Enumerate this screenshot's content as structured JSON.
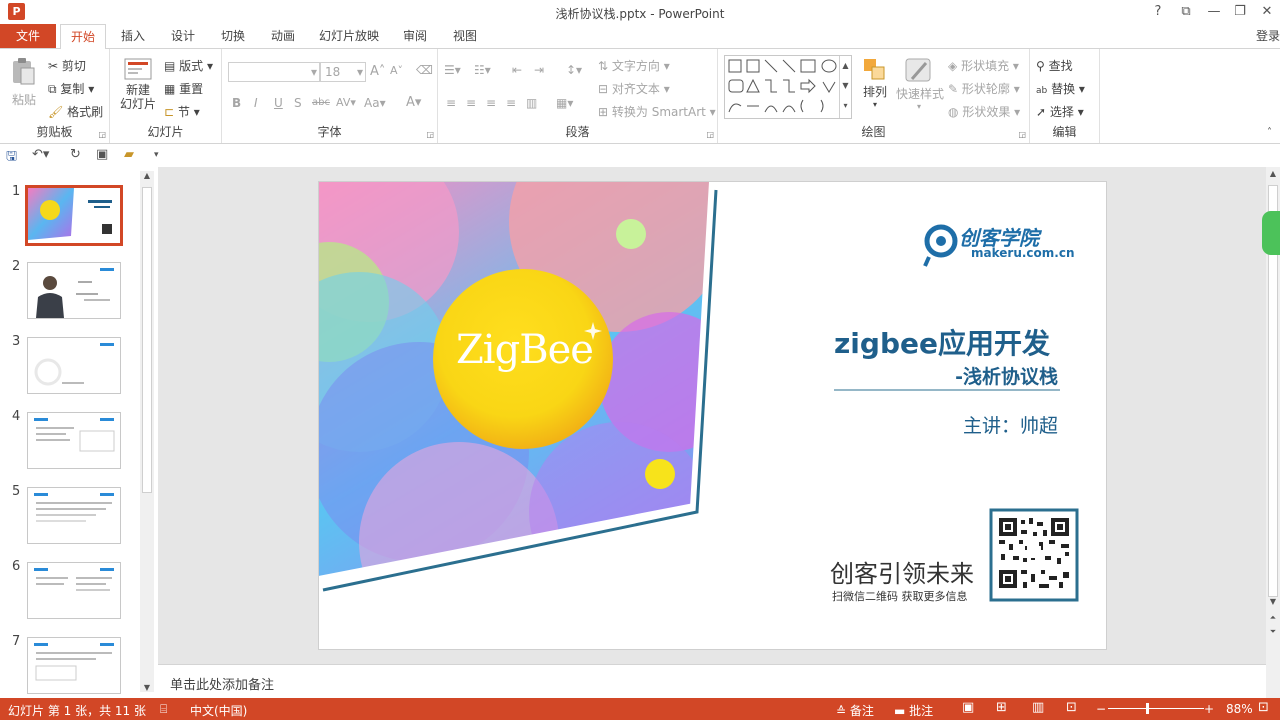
{
  "window": {
    "title": "浅析协议栈.pptx - PowerPoint",
    "app_icon": "P",
    "controls": [
      "?",
      "⧉",
      "—",
      "❐",
      "✕"
    ]
  },
  "tabs": [
    {
      "label": "文件"
    },
    {
      "label": "开始"
    },
    {
      "label": "插入"
    },
    {
      "label": "设计"
    },
    {
      "label": "切换"
    },
    {
      "label": "动画"
    },
    {
      "label": "幻灯片放映"
    },
    {
      "label": "审阅"
    },
    {
      "label": "视图"
    }
  ],
  "account": {
    "login": "登录"
  },
  "ribbon": {
    "clipboard": {
      "label": "剪贴板",
      "paste": "粘贴",
      "cut": "剪切",
      "copy": "复制",
      "format_painter": "格式刷"
    },
    "slides": {
      "label": "幻灯片",
      "new_slide_line1": "新建",
      "new_slide_line2": "幻灯片",
      "layout": "版式",
      "reset": "重置",
      "section": "节"
    },
    "font": {
      "label": "字体",
      "size": "18",
      "bold": "B",
      "italic": "I",
      "underline": "U",
      "shadow": "S",
      "strike": "abc",
      "spacing": "AV",
      "case": "Aa",
      "color": "A",
      "grow": "A",
      "shrink": "A"
    },
    "paragraph": {
      "label": "段落",
      "text_direction": "文字方向",
      "align_text": "对齐文本",
      "smartart": "转换为 SmartArt"
    },
    "drawing": {
      "label": "绘图",
      "arrange": "排列",
      "quick_styles": "快速样式",
      "shape_fill": "形状填充",
      "shape_outline": "形状轮廓",
      "shape_effects": "形状效果"
    },
    "editing": {
      "label": "编辑",
      "find": "查找",
      "replace": "替换",
      "select": "选择"
    }
  },
  "slides_pane": {
    "numbers": [
      "1",
      "2",
      "3",
      "4",
      "5",
      "6",
      "7"
    ],
    "selected": 1
  },
  "slide": {
    "logo_text": "创客学院",
    "logo_url": "makeru.com.cn",
    "zigbee_text": "ZigBee",
    "title": "zigbee应用开发",
    "subtitle": "-浅析协议栈",
    "presenter": "主讲：帅超",
    "slogan": "创客引领未来",
    "qr_caption": "扫微信二维码  获取更多信息"
  },
  "notes": {
    "placeholder": "单击此处添加备注"
  },
  "status": {
    "slide_info": "幻灯片 第 1 张，共 11 张",
    "language": "中文(中国)",
    "notes_btn": "备注",
    "comments_btn": "批注",
    "zoom": "88%"
  },
  "colors": {
    "accent": "#d24726",
    "slide_title": "#1f5f8b",
    "frame_line": "#2b6f8f"
  }
}
